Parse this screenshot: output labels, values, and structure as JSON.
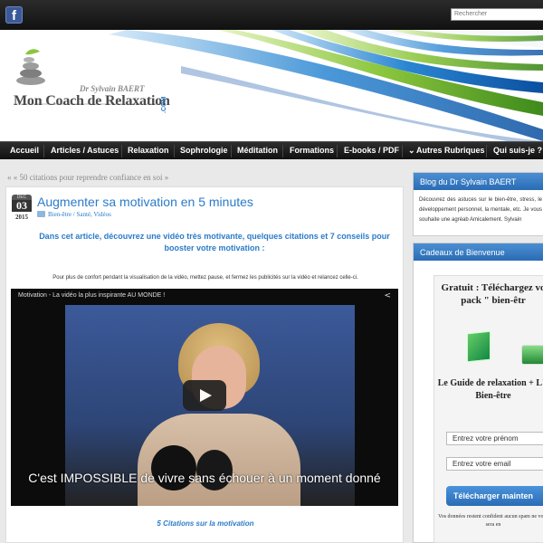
{
  "topbar": {
    "facebook_glyph": "f",
    "search_placeholder": "Rechercher"
  },
  "logo": {
    "author": "Dr Sylvain BAERT",
    "name": "Mon Coach de Relaxation",
    "tld": ".COM"
  },
  "nav": [
    {
      "label": "Accueil"
    },
    {
      "label": "Articles / Astuces"
    },
    {
      "label": "Relaxation"
    },
    {
      "label": "Sophrologie"
    },
    {
      "label": "Méditation"
    },
    {
      "label": "Formations"
    },
    {
      "label": "E-books / PDF"
    },
    {
      "label": "Autres Rubriques"
    },
    {
      "label": "Qui suis-je ?"
    }
  ],
  "breadcrumb": "« « 50 citations pour reprendre confiance en soi »",
  "article": {
    "date": {
      "month": "DEC",
      "day": "03",
      "year": "2015"
    },
    "title": "Augmenter sa motivation en 5 minutes",
    "categories": "Bien-être / Santé, Vidéos",
    "intro": "Dans cet article, découvrez une vidéo très motivante, quelques citations et 7 conseils pour booster votre motivation :",
    "note": "Pour plus de confort pendant la visualisation de la vidéo, mettez pause, et fermez les publicités sur la vidéo et relancez celle-ci.",
    "video": {
      "title": "Motivation - La vidéo la plus inspirante AU MONDE !",
      "subtitle": "C'est IMPOSSIBLE de vivre sans échouer à un moment donné"
    },
    "citations_heading": "5 Citations sur la motivation"
  },
  "sidebar": {
    "blog": {
      "heading": "Blog du Dr Sylvain BAERT",
      "text": "Découvrez des astuces sur le bien-être, stress, le développement personnel, la mentale, etc. Je vous souhaite une agréab Amicalement. Sylvain"
    },
    "gift": {
      "heading": "Cadeaux de Bienvenue",
      "offer": "Gratuit : Téléchargez vo pack \" bien-êtr",
      "guide": "Le Guide de relaxation + L'e Bien-être",
      "firstname_placeholder": "Entrez votre prénom",
      "email_placeholder": "Entrez votre email",
      "button": "Télécharger mainten",
      "privacy": "Vos données restent confident aucun spam ne vous sera en"
    }
  },
  "colors": {
    "accent": "#2a7bc9",
    "nav_bg": "#1a1a1a",
    "sidebar_head": "#3a7fc6"
  }
}
